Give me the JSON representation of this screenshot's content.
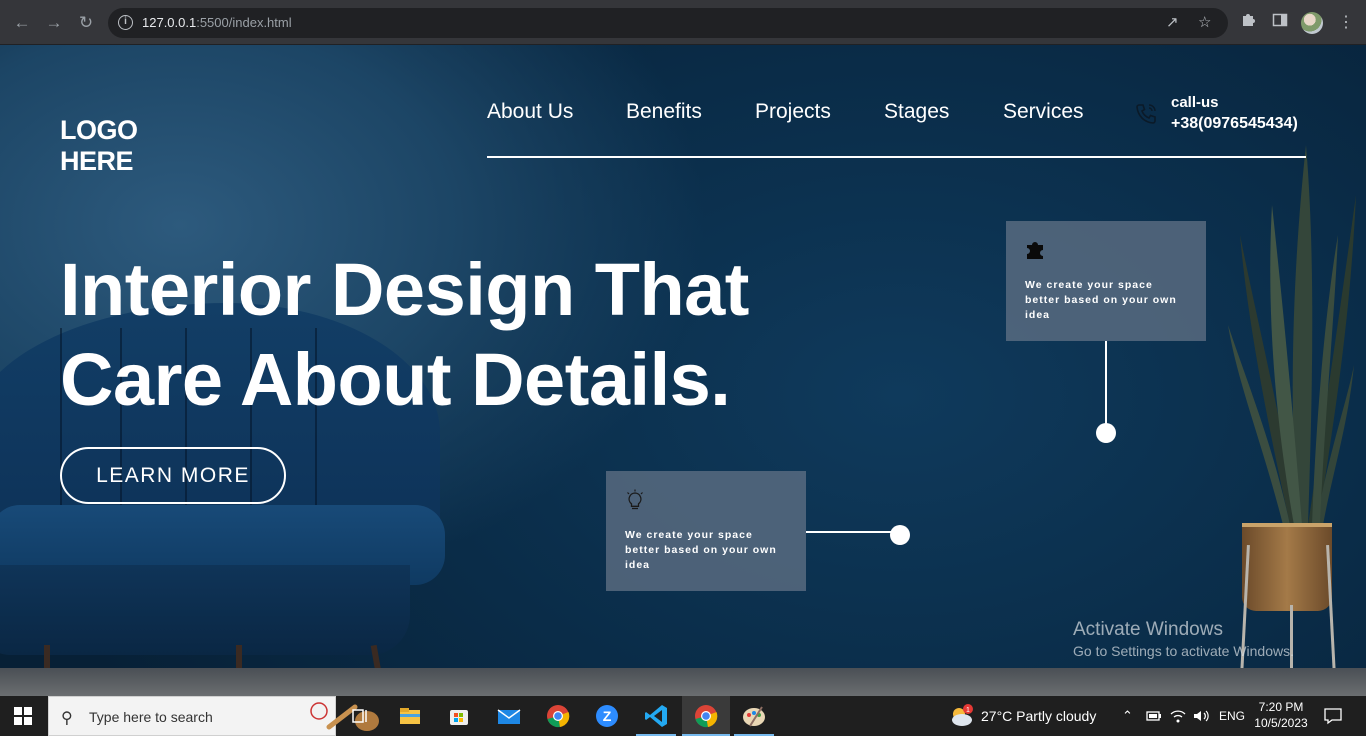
{
  "browser": {
    "url_host": "127.0.0.1",
    "url_path": ":5500/index.html"
  },
  "site": {
    "logo_line1": "LOGO",
    "logo_line2": "HERE",
    "nav": [
      "About Us",
      "Benefits",
      "Projects",
      "Stages",
      "Services"
    ],
    "call_title": "call-us",
    "call_number": "+38(0976545434)",
    "headline_line1": "Interior Design That",
    "headline_line2": "Care About Details.",
    "cta": "LEARN MORE",
    "card1_text": "We create your space better based on your own idea",
    "card2_text": "We create your space better based on your own idea"
  },
  "watermark": {
    "title": "Activate Windows",
    "subtitle": "Go to Settings to activate Windows."
  },
  "taskbar": {
    "search_placeholder": "Type here to search",
    "weather": "27°C  Partly cloudy",
    "weather_badge": "1",
    "language": "ENG",
    "time": "7:20 PM",
    "date": "10/5/2023"
  },
  "colors": {
    "hero_dark": "#0a2c48",
    "card_bg": "#5f7084",
    "accent_white": "#ffffff",
    "taskbar": "#1f1f1f"
  }
}
